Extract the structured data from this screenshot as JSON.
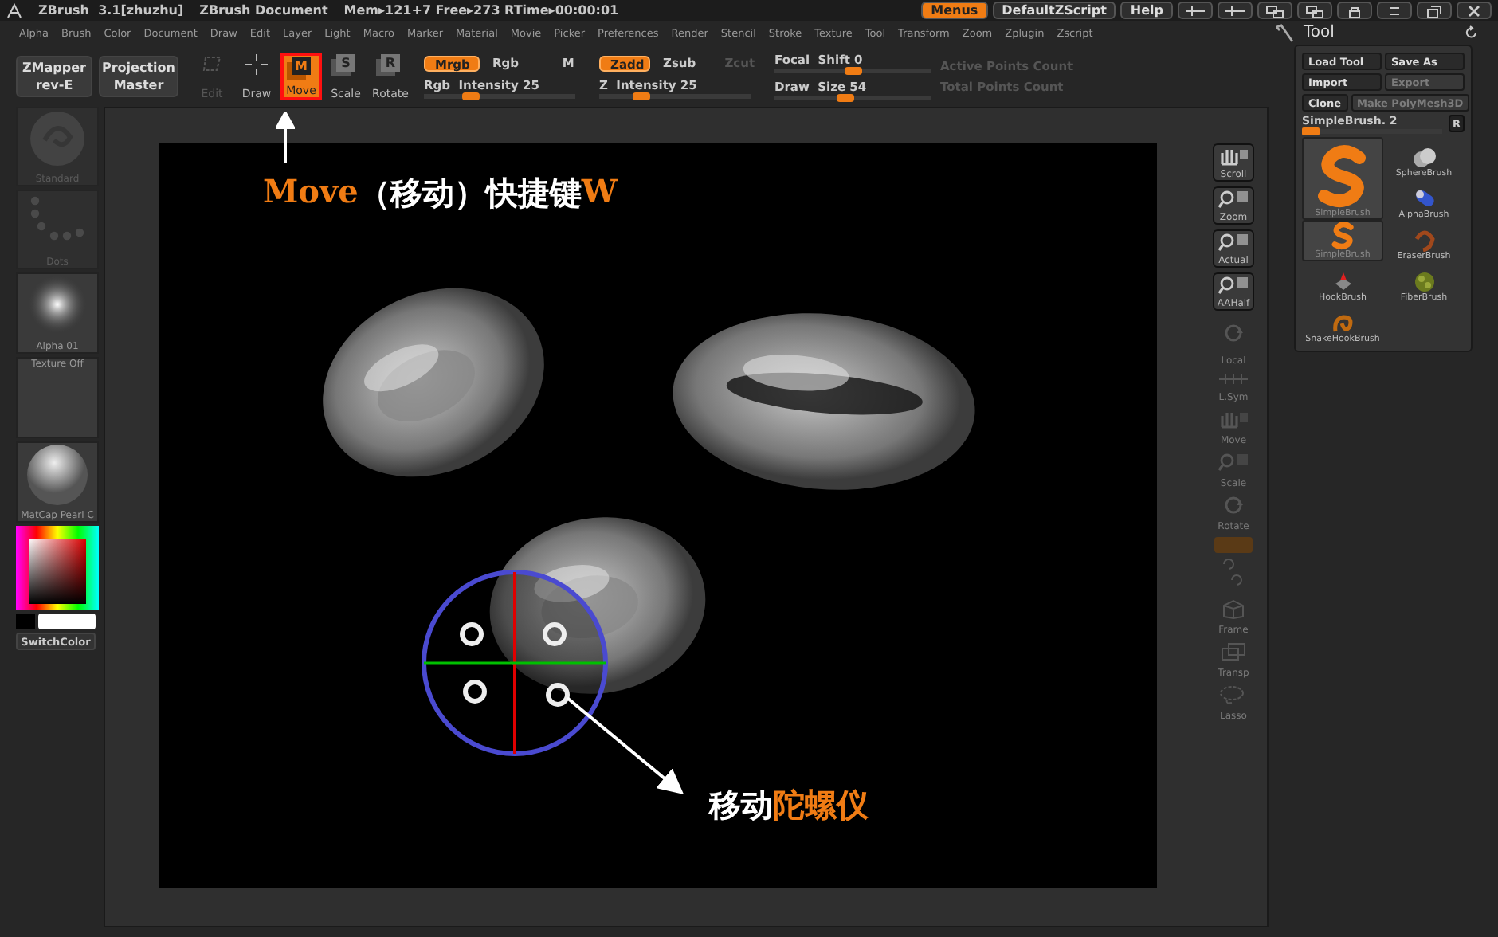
{
  "title_bar": {
    "app": "ZBrush  3.1[zhuzhu]",
    "document": "ZBrush Document",
    "stats": "Mem▸121+7 Free▸273 RTime▸00:00:01",
    "buttons": [
      {
        "label": "Menus",
        "selected": true
      },
      {
        "label": "DefaultZScript",
        "selected": false
      },
      {
        "label": "Help",
        "selected": false
      }
    ]
  },
  "menu": [
    "Alpha",
    "Brush",
    "Color",
    "Document",
    "Draw",
    "Edit",
    "Layer",
    "Light",
    "Macro",
    "Marker",
    "Material",
    "Movie",
    "Picker",
    "Preferences",
    "Render",
    "Stencil",
    "Stroke",
    "Texture",
    "Tool",
    "Transform",
    "Zoom",
    "Zplugin",
    "Zscript"
  ],
  "toolbar": {
    "big_buttons": [
      {
        "label": "ZMapper",
        "sub": "rev-E"
      },
      {
        "label": "Projection",
        "sub": "Master"
      }
    ],
    "tools": [
      {
        "kind": "edit",
        "label": "Edit",
        "selected": false,
        "disabled": true
      },
      {
        "kind": "draw",
        "label": "Draw",
        "selected": false,
        "disabled": false
      },
      {
        "kind": "glyph",
        "glyph": "M",
        "label": "Move",
        "selected": true,
        "disabled": false
      },
      {
        "kind": "glyph",
        "glyph": "S",
        "label": "Scale",
        "selected": false,
        "disabled": false
      },
      {
        "kind": "glyph",
        "glyph": "R",
        "label": "Rotate",
        "selected": false,
        "disabled": false
      }
    ],
    "color_modes": [
      {
        "label": "Mrgb",
        "selected": true
      },
      {
        "label": "Rgb",
        "selected": false
      },
      {
        "label": "M",
        "selected": false
      }
    ],
    "rgb_intensity": {
      "label": "Rgb  Intensity",
      "value": "25",
      "level": 0.3
    },
    "z_modes": [
      {
        "label": "Zadd",
        "selected": true,
        "disabled": false
      },
      {
        "label": "Zsub",
        "selected": false,
        "disabled": false
      },
      {
        "label": "Zcut",
        "selected": false,
        "disabled": true
      }
    ],
    "z_intensity": {
      "label": "Z  Intensity",
      "value": "25",
      "level": 0.27
    },
    "focal_shift": {
      "label": "Focal  Shift",
      "value": "0",
      "level": 0.5
    },
    "draw_size": {
      "label": "Draw  Size",
      "value": "54",
      "level": 0.45
    },
    "counts": [
      "Active Points Count",
      "Total Points Count"
    ]
  },
  "left_shelf": {
    "items": [
      {
        "kind": "material",
        "label": "Standard",
        "disabled": true
      },
      {
        "kind": "dots",
        "label": "Dots",
        "disabled": true
      },
      {
        "kind": "alpha",
        "label": "Alpha  01",
        "disabled": false
      },
      {
        "kind": "texture",
        "label": "Texture  Off",
        "disabled": false
      },
      {
        "kind": "sphere",
        "label": "MatCap  Pearl  C",
        "disabled": false
      }
    ],
    "switch_color": "SwitchColor"
  },
  "right_shelf": [
    {
      "kind": "scroll",
      "label": "Scroll",
      "disabled": false
    },
    {
      "kind": "zoom",
      "label": "Zoom",
      "disabled": false
    },
    {
      "kind": "actual",
      "label": "Actual",
      "disabled": false
    },
    {
      "kind": "aahalf",
      "label": "AAHalf",
      "disabled": false
    },
    {
      "kind": "local",
      "label": "Local",
      "disabled": true
    },
    {
      "kind": "lsym",
      "label": "L.Sym",
      "disabled": true
    },
    {
      "kind": "move",
      "label": "Move",
      "disabled": true
    },
    {
      "kind": "scale",
      "label": "Scale",
      "disabled": true
    },
    {
      "kind": "rotate",
      "label": "Rotate",
      "disabled": true
    },
    {
      "kind": "toggle",
      "disabled": true
    },
    {
      "kind": "axes",
      "disabled": true
    },
    {
      "kind": "frame",
      "label": "Frame",
      "disabled": true
    },
    {
      "kind": "transp",
      "label": "Transp",
      "disabled": true
    },
    {
      "kind": "lasso",
      "label": "Lasso",
      "disabled": true
    }
  ],
  "tool_palette": {
    "title": "Tool",
    "buttons": [
      {
        "label": "Load Tool",
        "disabled": false
      },
      {
        "label": "Save As",
        "disabled": false
      },
      {
        "label": "Import",
        "disabled": false
      },
      {
        "label": "Export",
        "disabled": true
      },
      {
        "label": "Clone",
        "disabled": false
      },
      {
        "label": "Make  PolyMesh3D",
        "disabled": true
      }
    ],
    "current": {
      "label": "SimpleBrush. 2",
      "level": 0.12
    },
    "reset": "R",
    "brushes": [
      {
        "kind": "sphere",
        "label": "SphereBrush",
        "selected": false
      },
      {
        "kind": "s_large",
        "label": "SimpleBrush",
        "selected": true
      },
      {
        "kind": "alpha",
        "label": "AlphaBrush",
        "selected": false
      },
      {
        "kind": "s",
        "label": "SimpleBrush",
        "selected": true
      },
      {
        "kind": "eraser",
        "label": "EraserBrush",
        "selected": false
      },
      {
        "kind": "hook",
        "label": "HookBrush",
        "selected": false
      },
      {
        "kind": "fiber",
        "label": "FiberBrush",
        "selected": false
      },
      {
        "kind": "snake",
        "label": "SnakeHookBrush",
        "selected": false
      }
    ]
  },
  "annotations": {
    "move_hint": [
      {
        "text": "Move",
        "highlight": true
      },
      {
        "text": "（移动）快捷键",
        "highlight": false
      },
      {
        "text": "W",
        "highlight": true
      }
    ],
    "gizmo_hint": [
      {
        "text": "移动",
        "highlight": false
      },
      {
        "text": "陀螺仪",
        "highlight": true
      }
    ]
  }
}
